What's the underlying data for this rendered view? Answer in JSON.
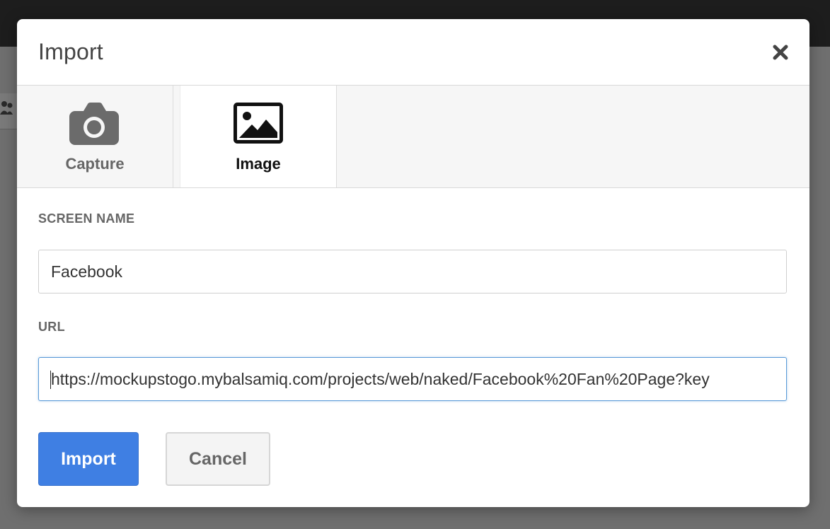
{
  "dialog": {
    "title": "Import",
    "close_icon": "close-icon"
  },
  "tabs": [
    {
      "label": "Capture",
      "icon": "camera-icon",
      "selected": false
    },
    {
      "label": "Image",
      "icon": "image-icon",
      "selected": true
    }
  ],
  "form": {
    "screen_name_label": "SCREEN NAME",
    "screen_name_value": "Facebook",
    "url_label": "URL",
    "url_value": "https://mockupstogo.mybalsamiq.com/projects/web/naked/Facebook%20Fan%20Page?key"
  },
  "buttons": {
    "import_label": "Import",
    "cancel_label": "Cancel"
  },
  "colors": {
    "primary": "#3f7fe3",
    "focus_border": "#5b9bd8",
    "overlay": "#6f6f6f"
  }
}
